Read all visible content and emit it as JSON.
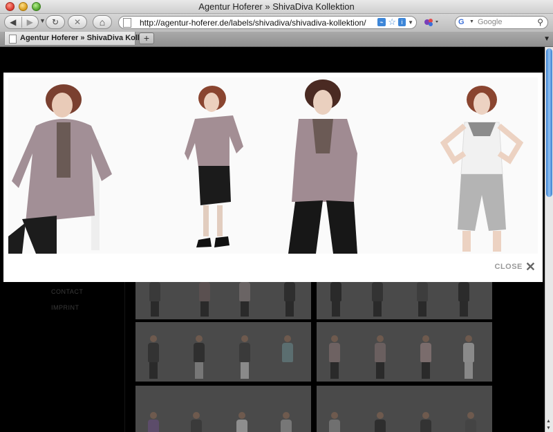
{
  "window": {
    "title": "Agentur Hoferer » ShivaDiva Kollektion"
  },
  "toolbar": {
    "url": "http://agentur-hoferer.de/labels/shivadiva/shivadiva-kollektion/",
    "search_placeholder": "Google",
    "rss_glyph": "⌁",
    "back_glyph": "◀",
    "forward_glyph": "▶",
    "reload_glyph": "↻",
    "stop_glyph": "✕",
    "home_glyph": "⌂",
    "star_glyph": "☆",
    "info_glyph": "i"
  },
  "tabs": [
    {
      "label": "Agentur Hoferer » ShivaDiva Kolle..."
    }
  ],
  "new_tab_glyph": "+",
  "page": {
    "nav": [
      {
        "label": "CONTACT"
      },
      {
        "label": "IMPRINT"
      }
    ]
  },
  "lightbox": {
    "close_label": "CLOSE",
    "close_glyph": "✕"
  },
  "colors": {
    "page_background": "#000000",
    "lightbox_background": "#ffffff",
    "thumbnail_overlay": "#4a4a4a",
    "scroll_thumb": "#3a7fd0"
  },
  "icons": [
    "back-icon",
    "forward-icon",
    "reload-icon",
    "stop-icon",
    "home-icon",
    "page-icon",
    "rss-icon",
    "bookmark-star-icon",
    "info-icon",
    "google-icon",
    "search-icon",
    "close-icon"
  ]
}
